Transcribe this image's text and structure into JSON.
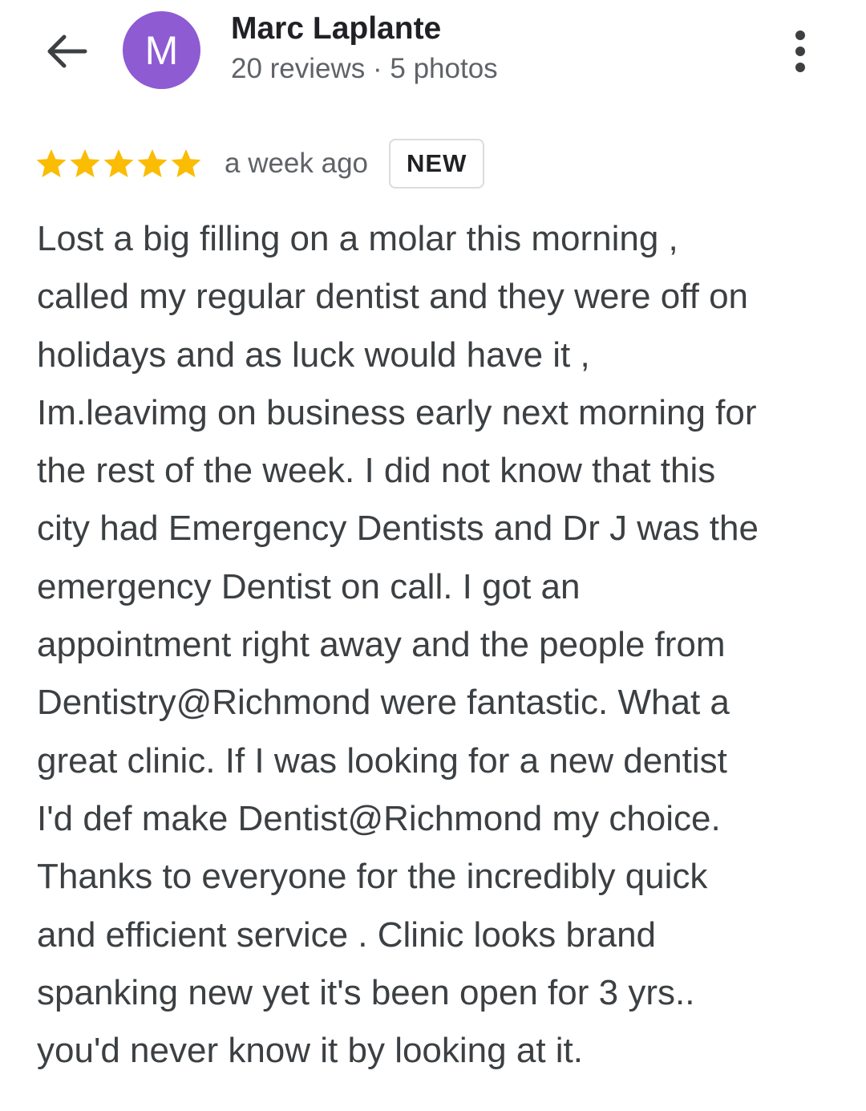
{
  "header": {
    "back_icon": "arrow-back-icon",
    "avatar_letter": "M",
    "avatar_color": "#8e5bd3",
    "user_name": "Marc Laplante",
    "user_meta": "20 reviews · 5 photos",
    "more_icon": "more-vertical-icon"
  },
  "rating": {
    "stars": 5,
    "max_stars": 5,
    "star_color": "#fbbc04",
    "time_ago": "a week ago",
    "badge": "NEW"
  },
  "review": {
    "lines": [
      "Lost a big filling on a molar this morning ,",
      "called my regular dentist and they were off on",
      "holidays and as luck would have it ,",
      "Im.leavimg on business early next morning for",
      "the rest of the week. I did not know that this",
      "city had Emergency Dentists and Dr J was the",
      "emergency Dentist on call. I got an",
      "appointment right away and the people from",
      "Dentistry@Richmond were fantastic. What a",
      "great clinic. If I was looking for a new dentist",
      "I'd def make Dentist@Richmond my choice.",
      "Thanks to everyone for the incredibly quick",
      "and efficient service . Clinic looks brand",
      "spanking new yet it's been open for 3 yrs..",
      "you'd never know it by looking at it."
    ]
  }
}
